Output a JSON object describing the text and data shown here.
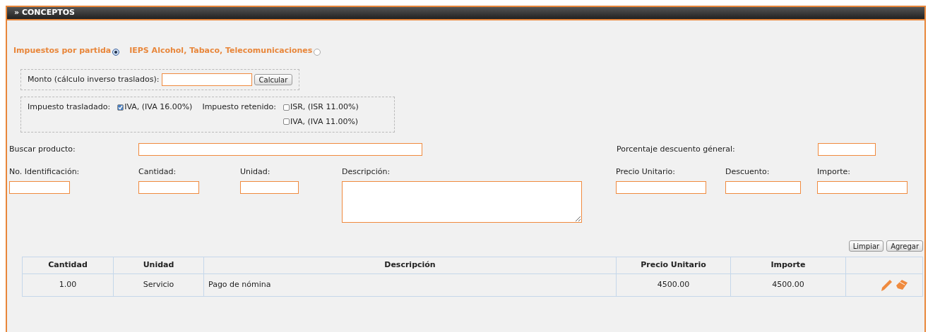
{
  "panel": {
    "title": "» CONCEPTOS"
  },
  "tax_modes": [
    {
      "label": "Impuestos por partida",
      "selected": true
    },
    {
      "label": "IEPS Alcohol, Tabaco, Telecomunicaciones",
      "selected": false
    }
  ],
  "reverse_calc": {
    "label": "Monto (cálculo inverso traslados):",
    "button": "Calcular"
  },
  "taxes": {
    "transferred_label": "Impuesto trasladado:",
    "transferred": [
      {
        "label": "IVA, (IVA 16.00%)",
        "checked": true
      }
    ],
    "withheld_label": "Impuesto retenido:",
    "withheld": [
      {
        "label": "ISR, (ISR 11.00%)",
        "checked": false
      },
      {
        "label": "IVA, (IVA 11.00%)",
        "checked": false
      }
    ]
  },
  "search": {
    "label": "Buscar producto:",
    "discount_label": "Porcentaje descuento géneral:"
  },
  "fields": [
    {
      "label": "No. Identificación:",
      "kind": "input"
    },
    {
      "label": "Cantidad:",
      "kind": "input"
    },
    {
      "label": "Unidad:",
      "kind": "input"
    },
    {
      "label": "Descripción:",
      "kind": "textarea"
    },
    {
      "label": "Precio Unitario:",
      "kind": "input"
    },
    {
      "label": "Descuento:",
      "kind": "input"
    },
    {
      "label": "Importe:",
      "kind": "input"
    }
  ],
  "buttons": [
    "Limpiar",
    "Agregar"
  ],
  "table": {
    "columns": [
      "Cantidad",
      "Unidad",
      "Descripción",
      "Precio Unitario",
      "Importe"
    ],
    "rows": [
      {
        "cells": [
          "1.00",
          "Servicio",
          "Pago de nómina",
          "4500.00",
          "4500.00"
        ]
      }
    ]
  }
}
